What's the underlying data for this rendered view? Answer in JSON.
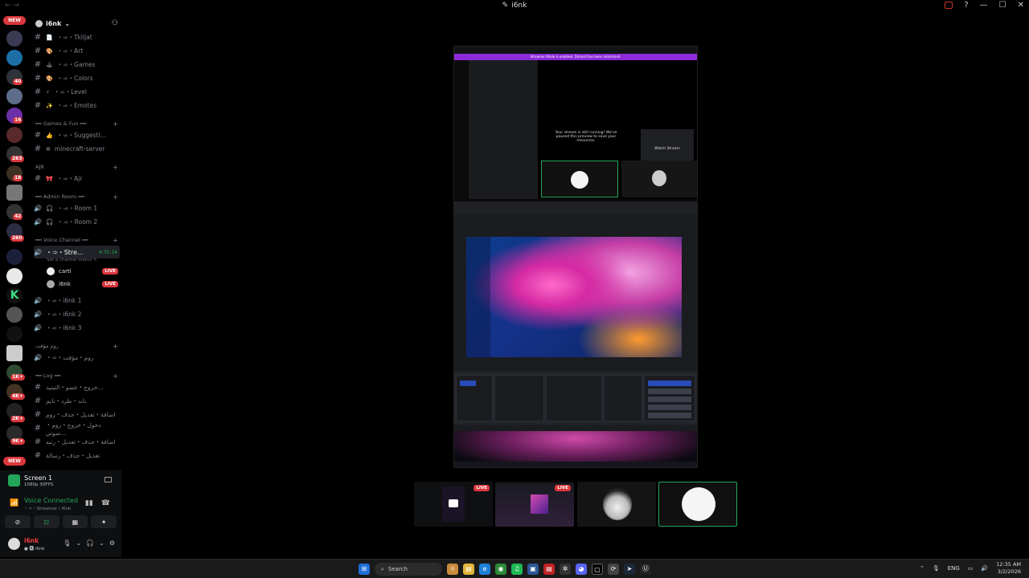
{
  "window": {
    "title": "i6nk",
    "nav": "← →"
  },
  "server": {
    "name": "i6nk"
  },
  "channels": {
    "top": [
      {
        "emoji": "📄",
        "label": "・➾・Tkiljat"
      },
      {
        "emoji": "🎨",
        "label": "・➾・Art"
      },
      {
        "emoji": "🕹",
        "label": "・➾・Games"
      },
      {
        "emoji": "🎨",
        "label": "・➾・Colors"
      },
      {
        "emoji": "⚡",
        "label": "・➾・Level"
      },
      {
        "emoji": "✨",
        "label": "・➾・Emotes"
      }
    ],
    "cat_games": "━━ Games & Fun ━━",
    "games": [
      {
        "emoji": "👍",
        "label": "・➾・Suggesti..."
      },
      {
        "emoji": "❇",
        "label": "minecraft-server"
      }
    ],
    "cat_ajr": "AJR",
    "ajr": [
      {
        "emoji": "🎀",
        "label": "・➾・Ajr"
      }
    ],
    "cat_admin": "━━ Admin Room ━━",
    "admin": [
      {
        "label": "・➾・Room 1"
      },
      {
        "label": "・➾・Room 2"
      }
    ],
    "cat_voice": "━━ Voice Channel ━━",
    "active_voice": {
      "label": "・➾・Stre...",
      "timer": "4:35:14",
      "status": "Set a channel status ✎"
    },
    "voice_users": [
      {
        "name": "carti",
        "live": "LIVE"
      },
      {
        "name": "i6nk",
        "live": "LIVE"
      }
    ],
    "voice_rooms": [
      {
        "label": "・➾・i6nk 1"
      },
      {
        "label": "・➾・i6nk 2"
      },
      {
        "label": "・➾・i6nk 3"
      }
    ],
    "cat_arabic": "روم مؤقت",
    "arabic_room": {
      "label": "・➾・روم・مؤقت"
    },
    "cat_log": "━━ Log ━━",
    "logs": [
      {
        "label": "خروج・عضو・التبنيد..."
      },
      {
        "label": "باند・طرد・تايم"
      },
      {
        "label": "اضافة・تعديل・حذف・روم"
      },
      {
        "label": "دخول・خروج・روم・صوتي..."
      },
      {
        "label": "اضافة・حذف・تعديل・رتبه"
      },
      {
        "label": "تعديل・حذف・رسالة"
      }
    ]
  },
  "rail": {
    "new_top": "NEW",
    "new_bottom": "NEW",
    "badges": [
      "40",
      "16",
      "263",
      "18",
      "42",
      "260",
      "1K+",
      "4K+",
      "2K+",
      "9K+"
    ]
  },
  "screenshare": {
    "title": "Screen 1",
    "sub": "1080p 30FPS"
  },
  "voice": {
    "title": "Voice Connected",
    "sub": "・➾・Streamer / i6nk"
  },
  "user": {
    "name": "i6nk",
    "sub": "● 🅺 i6nk"
  },
  "stream": {
    "inner_banner": "Streamer Mode is enabled. Discord has been minimized. ",
    "inner_msg": "Your stream is still running! We've paused this preview to save your resources.",
    "inner_watch": "Watch Stream"
  },
  "tiles": [
    {
      "live": "LIVE"
    },
    {
      "live": "LIVE"
    },
    {},
    {}
  ],
  "taskbar": {
    "search": "Search",
    "lang": "ENG",
    "time": "12:35 AM",
    "date": "3/2/2026"
  }
}
